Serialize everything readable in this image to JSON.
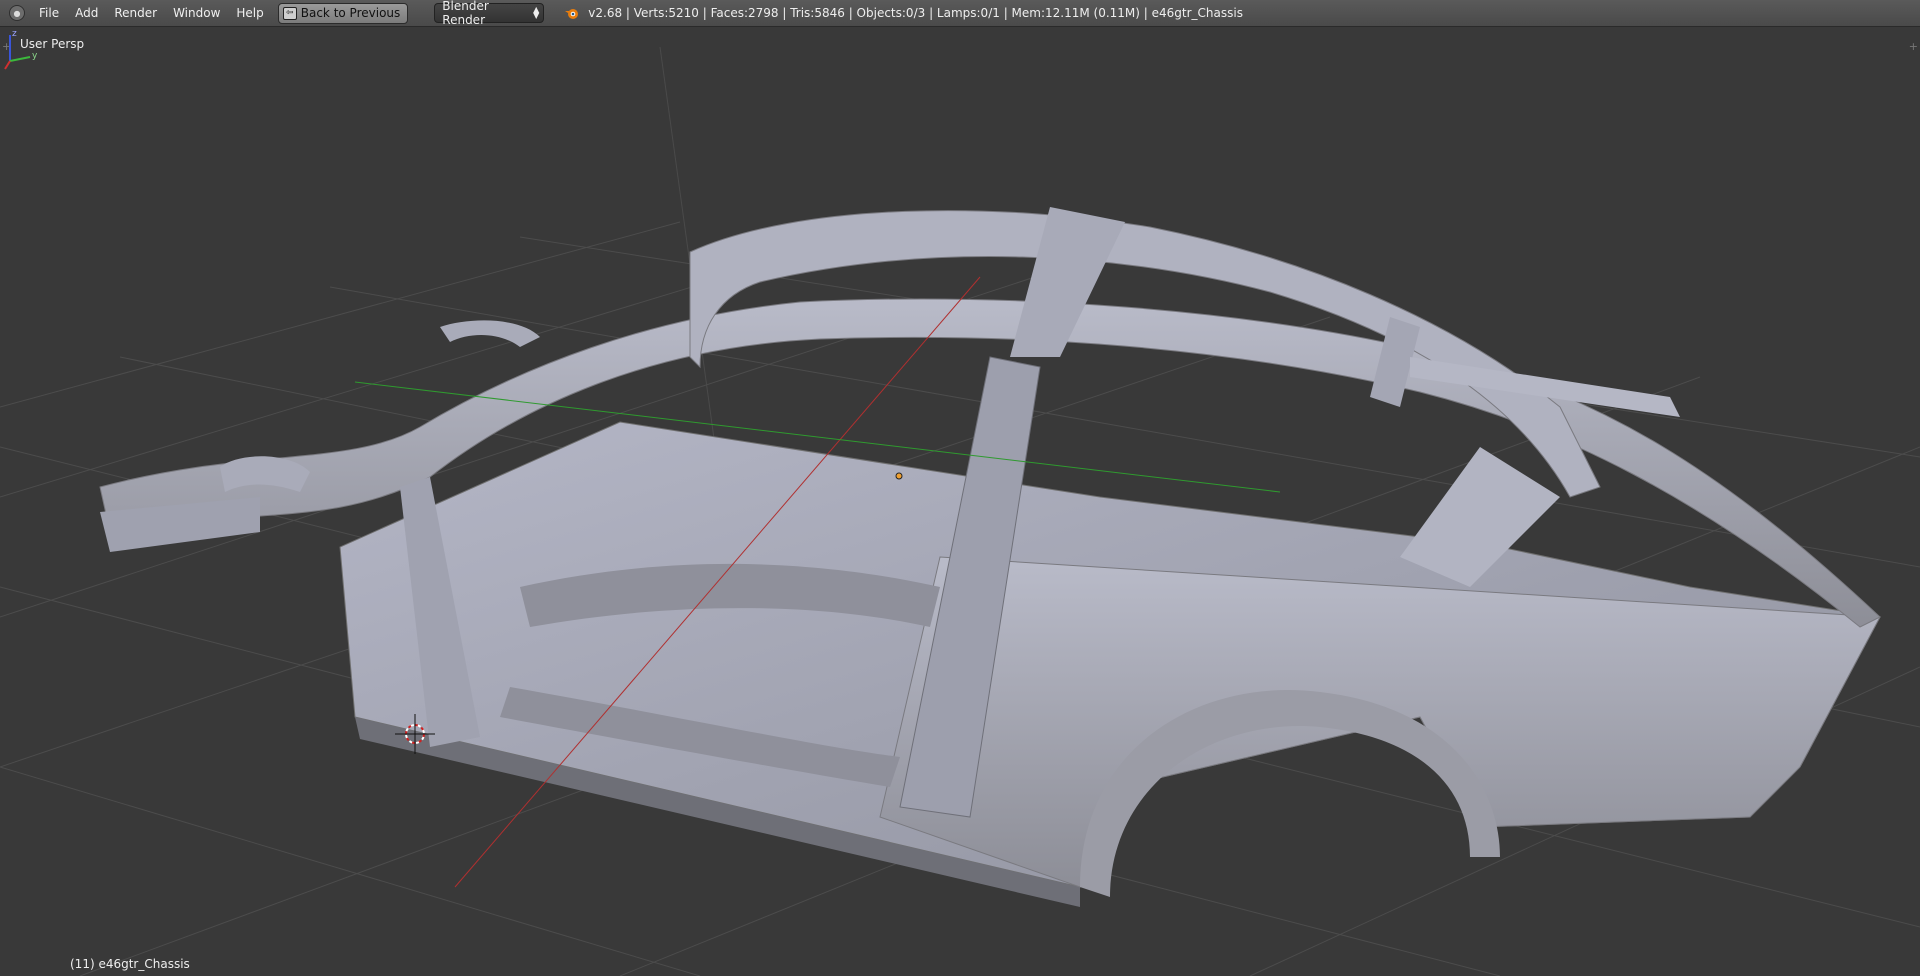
{
  "header": {
    "editor_type_icon": "info-editor-icon",
    "menus": [
      "File",
      "Add",
      "Render",
      "Window",
      "Help"
    ],
    "back_button": "Back to Previous",
    "render_engine": "Blender Render",
    "stats": "v2.68 | Verts:5210 | Faces:2798 | Tris:5846 | Objects:0/3 | Lamps:0/1 | Mem:12.11M (0.11M) | e46gtr_Chassis"
  },
  "viewport": {
    "view_name": "User Persp",
    "object_info": "(11) e46gtr_Chassis",
    "gizmo_labels": {
      "z": "z",
      "y": "y"
    }
  },
  "colors": {
    "background": "#393939",
    "header": "#4f4f4f",
    "mesh": "#a9abb8",
    "x_axis": "#b03030",
    "y_axis": "#2f9a2f",
    "origin": "#f0a030"
  }
}
